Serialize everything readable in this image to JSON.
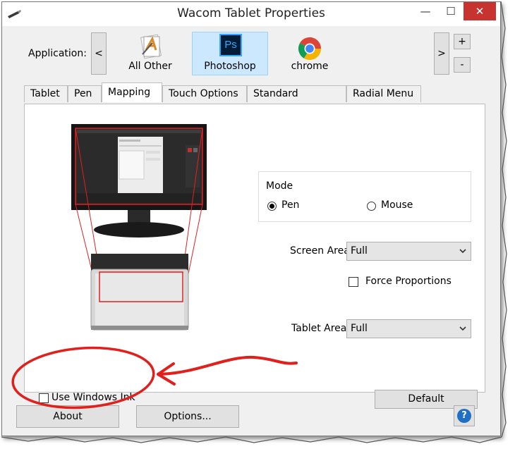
{
  "window": {
    "title": "Wacom Tablet Properties",
    "minimize_glyph": "—",
    "maximize_glyph": "☐",
    "close_glyph": "✕"
  },
  "application": {
    "label": "Application:",
    "prev_glyph": "<",
    "next_glyph": ">",
    "add_glyph": "+",
    "remove_glyph": "-",
    "apps": [
      {
        "label": "All Other",
        "icon": "all-other-icon"
      },
      {
        "label": "Photoshop",
        "icon": "photoshop-icon",
        "selected": true
      },
      {
        "label": "chrome",
        "icon": "chrome-icon"
      }
    ]
  },
  "tabs": [
    "Tablet",
    "Pen",
    "Mapping",
    "Touch Options",
    "Standard Gestures",
    "Radial Menu"
  ],
  "active_tab": "Mapping",
  "mapping": {
    "mode": {
      "title": "Mode",
      "options": [
        "Pen",
        "Mouse"
      ],
      "selected": "Pen"
    },
    "screen_area": {
      "label": "Screen Area:",
      "value": "Full"
    },
    "force_proportions": {
      "label": "Force Proportions",
      "checked": false
    },
    "tablet_area": {
      "label": "Tablet Area:",
      "value": "Full"
    },
    "use_windows_ink": {
      "label": "Use Windows Ink",
      "checked": false
    },
    "default_button": "Default"
  },
  "footer": {
    "about_button": "About",
    "options_button": "Options...",
    "help_glyph": "?"
  },
  "icons": {
    "photoshop_text": "Ps"
  },
  "colors": {
    "annotation_red": "#e0201c",
    "selected_tile_bg": "#cce8ff",
    "close_button_bg": "#c7332f",
    "photoshop_bg": "#001c36",
    "photoshop_fg": "#31a8ff",
    "help_blue": "#1f6fc7"
  }
}
